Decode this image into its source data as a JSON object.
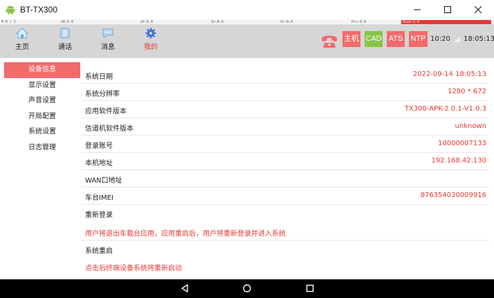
{
  "window": {
    "title": "BT-TX300"
  },
  "debug": {
    "items": [
      "P:0 / 1",
      "dX:0.0",
      "dY:0.0",
      "Xv:0.0",
      "Yv:0.0",
      "Prs:0.0",
      "Size:1.0"
    ]
  },
  "nav": {
    "items": [
      {
        "label": "主页",
        "icon": "home-icon"
      },
      {
        "label": "通话",
        "icon": "contacts-icon"
      },
      {
        "label": "消息",
        "icon": "message-icon"
      },
      {
        "label": "我的",
        "icon": "gear-icon",
        "active": true
      }
    ]
  },
  "status": {
    "buttons": [
      {
        "label": "主机",
        "color": "#f26b6b"
      },
      {
        "label": "CAD",
        "color": "#8bc34a"
      },
      {
        "label": "ATS",
        "color": "#f26b6b"
      },
      {
        "label": "NTP",
        "color": "#f26b6b"
      }
    ],
    "time1": "10:20",
    "time2": "18:05:13"
  },
  "sidebar": {
    "items": [
      "设备信息",
      "显示设置",
      "声音设置",
      "开局配置",
      "系统设置",
      "日志管理"
    ],
    "active": 0
  },
  "info": {
    "rows": [
      {
        "key": "系统日期",
        "value": "2022-09-14 18:05:13"
      },
      {
        "key": "系统分辨率",
        "value": "1280 * 672"
      },
      {
        "key": "应用软件版本",
        "value": "TX300-APK-2.0.1-V1.0.3"
      },
      {
        "key": "信道机软件版本",
        "value": "unknown"
      },
      {
        "key": "登录账号",
        "value": "10000007133"
      },
      {
        "key": "本机地址",
        "value": "192.168.42.130"
      },
      {
        "key": "WAN口地址",
        "value": ""
      },
      {
        "key": "车台IMEI",
        "value": "876354030009916"
      }
    ],
    "relogin": {
      "label": "重新登录",
      "note": "用户将退出车载台应用，应用重启后，用户将重新登录并进入系统"
    },
    "reboot": {
      "label": "系统重启",
      "note": "点击后终端设备系统将重新启动"
    }
  },
  "colors": {
    "accent": "#e53935",
    "sidebar_active": "#f26b6b",
    "navbar": "#d6d6d6"
  }
}
